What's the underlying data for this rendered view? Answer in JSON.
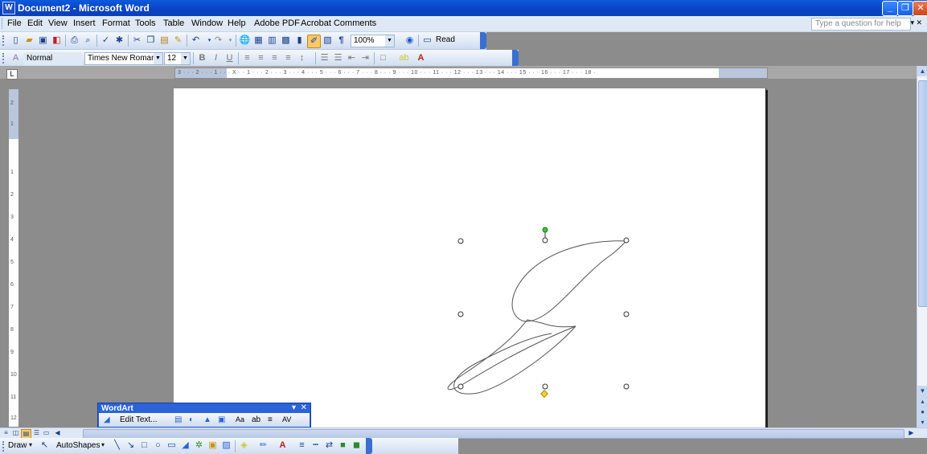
{
  "window": {
    "title": "Document2 - Microsoft Word",
    "app_icon": "W"
  },
  "menubar": {
    "items": [
      "File",
      "Edit",
      "View",
      "Insert",
      "Format",
      "Tools",
      "Table",
      "Window",
      "Help",
      "Adobe PDF",
      "Acrobat Comments"
    ],
    "help_placeholder": "Type a question for help"
  },
  "standard_toolbar": {
    "zoom": "100%",
    "read_label": "Read"
  },
  "formatting_toolbar": {
    "style": "Normal",
    "font": "Times New Roman",
    "size": "12"
  },
  "ruler": {
    "horizontal_numbers": "3 · · · 2 · · · 1 · · · X · · 1 · · · 2 · · · 3 · · · 4 · · · 5 · · · 6 · · · 7 · · · 8 · · · 9 · · · 10 · · · 11 · · · 12 · · · 13 · · · 14 · · · 15 · · · 16 · · · 17 · · · 18 ·",
    "vertical_numbers": [
      "2",
      "1",
      "1",
      "2",
      "3",
      "4",
      "5",
      "6",
      "7",
      "8",
      "9",
      "10",
      "11",
      "12"
    ],
    "tab_selector": "L"
  },
  "wordart_toolbar": {
    "title": "WordArt",
    "edit_text_label": "Edit Text..."
  },
  "drawing_toolbar": {
    "draw_label": "Draw",
    "autoshapes_label": "AutoShapes"
  },
  "document": {
    "wordart_letter": "J"
  }
}
